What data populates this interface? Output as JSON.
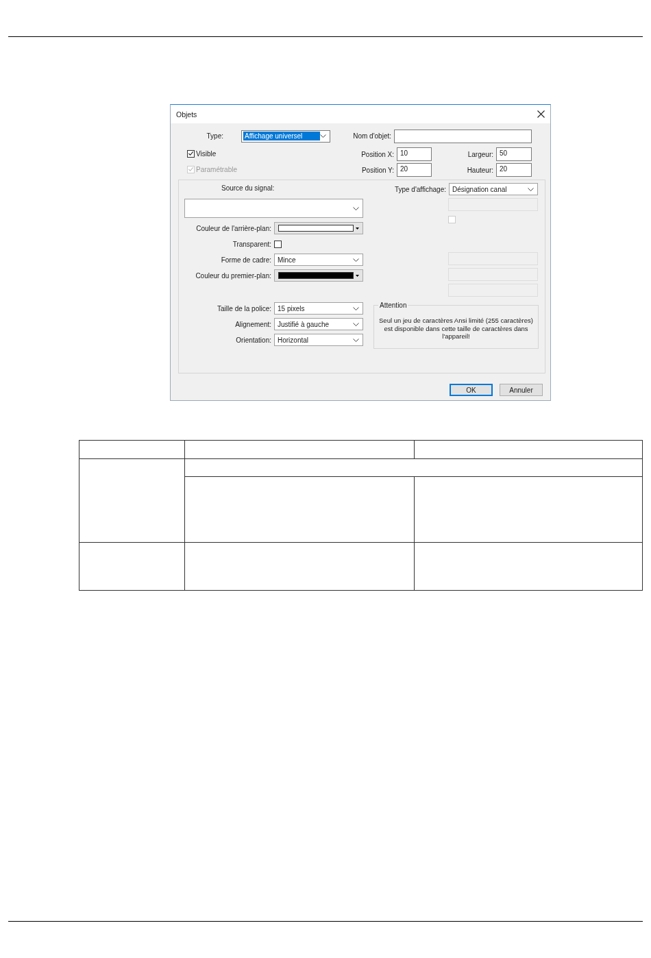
{
  "dialog": {
    "title": "Objets",
    "type": {
      "label": "Type:",
      "value": "Affichage universel",
      "focused": true
    },
    "object_name": {
      "label": "Nom d'objet:"
    },
    "checkboxes": [
      {
        "label": "Visible",
        "checked": true,
        "disabled": false
      },
      {
        "label": "Paramétrable",
        "checked": true,
        "disabled": true
      }
    ],
    "position_fields": [
      {
        "label": "Position X:",
        "value": "10"
      },
      {
        "label": "Largeur:",
        "value": "50"
      },
      {
        "label": "Position Y:",
        "value": "20"
      },
      {
        "label": "Hauteur:",
        "value": "20"
      }
    ],
    "signal_source": {
      "label": "Source du signal:"
    },
    "appearance": [
      {
        "kind": "color",
        "label": "Couleur de l'arrière-plan:",
        "color": "#ffffff"
      },
      {
        "kind": "checkbox",
        "label": "Transparent:",
        "checked": false
      },
      {
        "kind": "combo",
        "label": "Forme de cadre:",
        "value": "Mince"
      },
      {
        "kind": "color",
        "label": "Couleur du premier-plan:",
        "color": "#000000"
      }
    ],
    "text_format": [
      {
        "kind": "combo",
        "label": "Taille de la police:",
        "value": "15 pixels"
      },
      {
        "kind": "combo",
        "label": "Alignement:",
        "value": "Justifié à gauche"
      },
      {
        "kind": "combo",
        "label": "Orientation:",
        "value": "Horizontal"
      }
    ],
    "display_type": {
      "label": "Type d'affichage:",
      "value": "Désignation canal"
    },
    "side_controls": [
      {
        "kind": "field",
        "disabled": true
      },
      {
        "kind": "checkbox",
        "disabled": true,
        "checked": false
      }
    ],
    "side_fields": [
      {
        "kind": "field",
        "disabled": true
      },
      {
        "kind": "field",
        "disabled": true
      },
      {
        "kind": "field",
        "disabled": true
      }
    ],
    "notice": {
      "title": "Attention",
      "text": "Seul un jeu de caractères Ansi limité (255 caractères) est disponible dans cette taille de caractères dans l'appareil!"
    },
    "buttons": [
      {
        "label": "OK",
        "default": true
      },
      {
        "label": "Annuler",
        "default": false
      }
    ]
  }
}
